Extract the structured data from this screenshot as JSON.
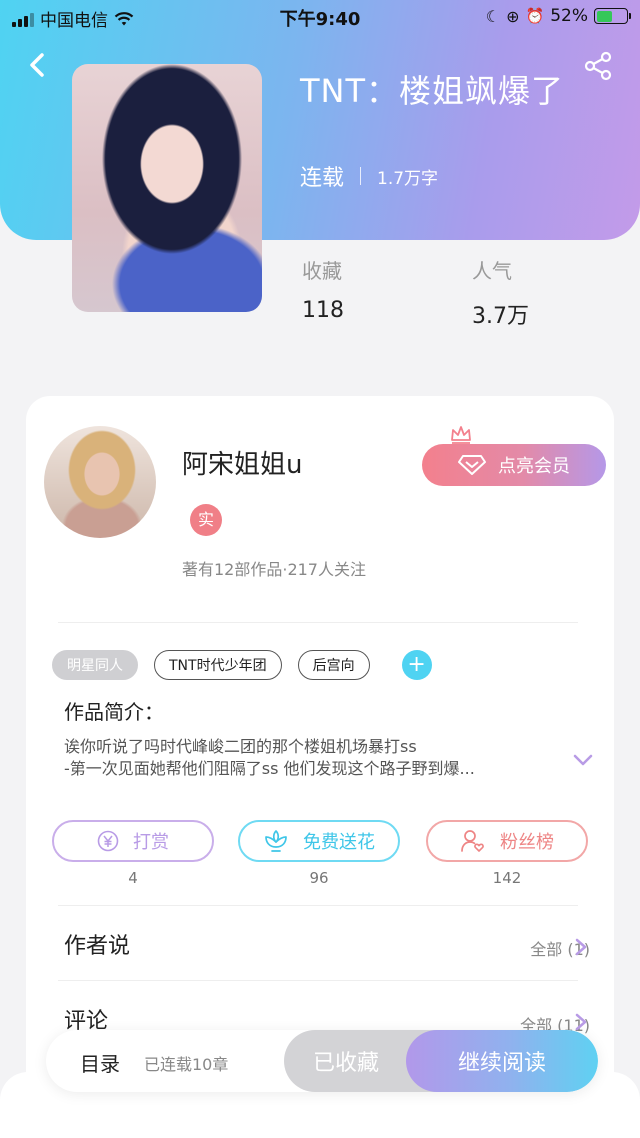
{
  "status_bar": {
    "carrier": "中国电信",
    "time": "下午9:40",
    "battery": "52%",
    "battery_level": 0.52
  },
  "book": {
    "title": "TNT：楼姐飒爆了",
    "status": "连载",
    "word_count": "1.7万字",
    "stats": [
      {
        "label": "收藏",
        "value": "118"
      },
      {
        "label": "人气",
        "value": "3.7万"
      }
    ]
  },
  "author": {
    "name": "阿宋姐姐u",
    "real_badge": "实",
    "summary": "著有12部作品·217人关注",
    "vip_button": "点亮会员"
  },
  "tags": [
    "明星同人",
    "TNT时代少年团",
    "后宫向"
  ],
  "tag_add": "+",
  "intro": {
    "title": "作品简介：",
    "lines": [
      "诶你听说了吗时代峰峻二团的那个楼姐机场暴打ss",
      "-第一次见面她帮他们阻隔了ss 他们发现这个路子野到爆..."
    ]
  },
  "actions": [
    {
      "label": "打赏",
      "count": "4",
      "color": "#b89be6"
    },
    {
      "label": "免费送花",
      "count": "96",
      "color": "#4fd3f2"
    },
    {
      "label": "粉丝榜",
      "count": "142",
      "color": "#f08c8c"
    }
  ],
  "rows": [
    {
      "title": "作者说",
      "right": "全部 (1)"
    },
    {
      "title": "评论",
      "right": "全部 (11)"
    }
  ],
  "bottom_bar": {
    "toc": "目录",
    "toc_sub": "已连载10章",
    "favorite": "已收藏",
    "read": "继续阅读"
  },
  "colors": {
    "accent_cyan": "#4fd3f2",
    "accent_purple": "#b89be6",
    "accent_pink": "#f3808d"
  },
  "icons": [
    "back-icon",
    "share-icon",
    "crown-icon",
    "diamond-icon",
    "plus-icon",
    "chevron-down-icon",
    "yen-icon",
    "flower-icon",
    "user-heart-icon",
    "chevron-right-icon"
  ]
}
